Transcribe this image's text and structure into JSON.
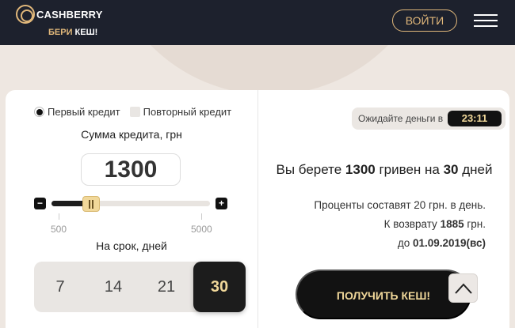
{
  "header": {
    "logo_text": "CASHBERRY",
    "slogan_part1": "БЕРИ ",
    "slogan_part2": "КЕШ!",
    "login_label": "ВОЙТИ",
    "menu_icon": "hamburger-menu-icon"
  },
  "calculator": {
    "credit_type": {
      "first_label": "Первый кредит",
      "repeat_label": "Повторный кредит",
      "selected": "first"
    },
    "amount_title": "Сумма кредита, грн",
    "amount_value": "1300",
    "slider": {
      "min_label": "500",
      "max_label": "5000",
      "min": 500,
      "max": 5000,
      "value": 1300
    },
    "minus_label": "−",
    "plus_label": "+",
    "term_title": "На срок, дней",
    "terms": [
      "7",
      "14",
      "21",
      "30"
    ],
    "selected_term": "30"
  },
  "result": {
    "wait_label": "Ожидайте деньги в",
    "timer": "23:11",
    "summary_prefix": "Вы берете ",
    "summary_amount": "1300",
    "summary_mid": " гривен на ",
    "summary_days": "30",
    "summary_suffix": " дней",
    "interest_text": "Проценты составят 20 грн. в день.",
    "return_prefix": "К возврату ",
    "return_amount": "1885",
    "return_suffix": " грн.",
    "due_prefix": "до ",
    "due_date": "01.09.2019(вс)",
    "cta_label": "ПОЛУЧИТЬ КЕШ!"
  },
  "colors": {
    "header_bg": "#1d212d",
    "accent_gold": "#e0b77a",
    "cta_bg": "#121212",
    "cta_text": "#f1d89a"
  }
}
